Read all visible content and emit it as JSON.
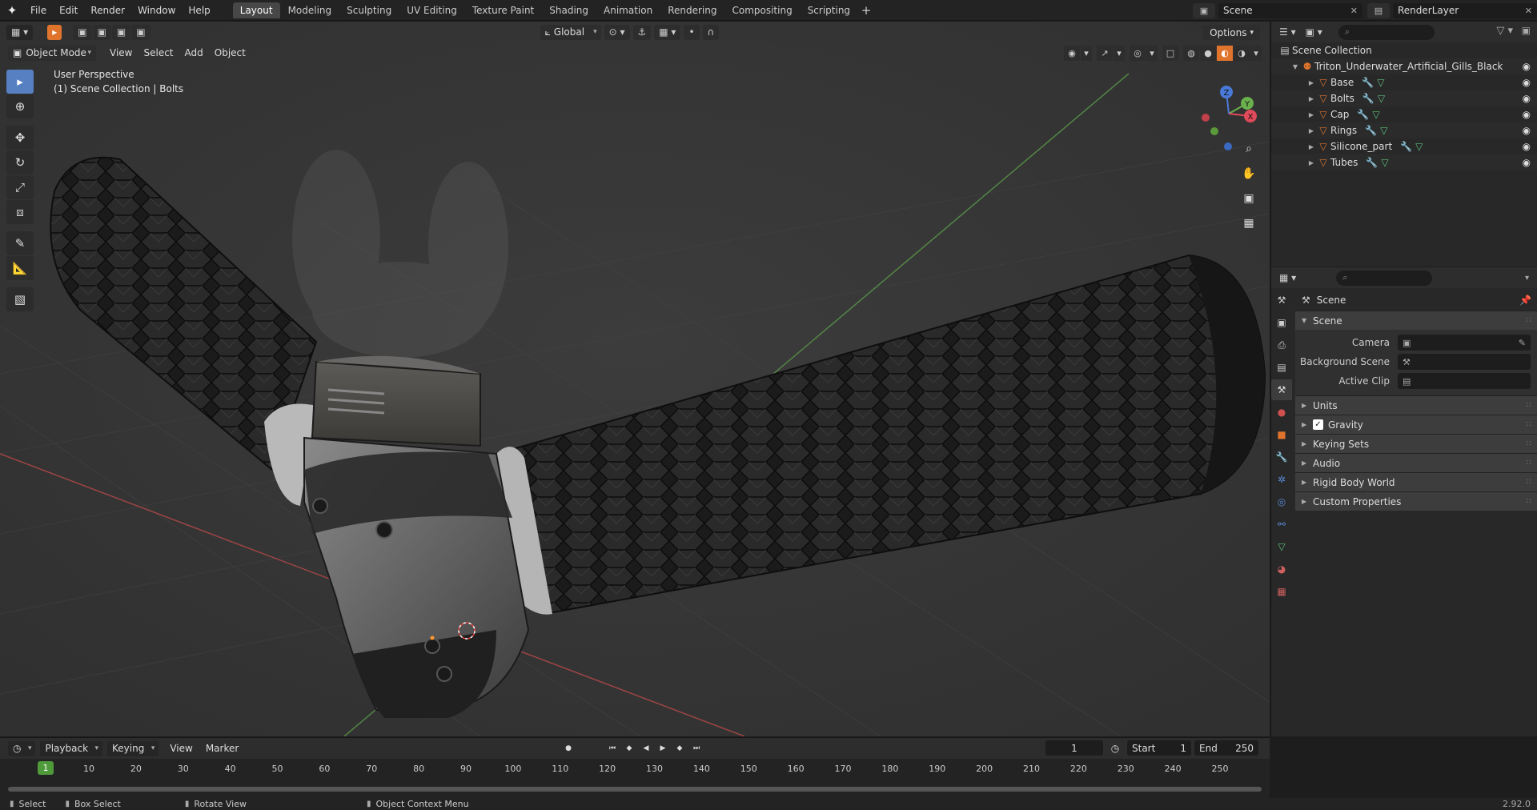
{
  "menu": [
    "File",
    "Edit",
    "Render",
    "Window",
    "Help"
  ],
  "workspaces": [
    {
      "label": "Layout",
      "active": true
    },
    {
      "label": "Modeling"
    },
    {
      "label": "Sculpting"
    },
    {
      "label": "UV Editing"
    },
    {
      "label": "Texture Paint"
    },
    {
      "label": "Shading"
    },
    {
      "label": "Animation"
    },
    {
      "label": "Rendering"
    },
    {
      "label": "Compositing"
    },
    {
      "label": "Scripting"
    }
  ],
  "scene_name": "Scene",
  "view_layer": "RenderLayer",
  "viewport": {
    "mode": "Object Mode",
    "menus": [
      "View",
      "Select",
      "Add",
      "Object"
    ],
    "transform_orientation": "Global",
    "options_label": "Options",
    "overlay_line1": "User Perspective",
    "overlay_line2": "(1) Scene Collection | Bolts"
  },
  "gizmo_axes": {
    "x": "X",
    "y": "Y",
    "z": "Z"
  },
  "outliner": {
    "root": "Scene Collection",
    "object": "Triton_Underwater_Artificial_Gills_Black",
    "children": [
      "Base",
      "Bolts",
      "Cap",
      "Rings",
      "Silicone_part",
      "Tubes"
    ]
  },
  "properties": {
    "context": "Scene",
    "panel": "Scene",
    "rows": [
      {
        "label": "Camera"
      },
      {
        "label": "Background Scene"
      },
      {
        "label": "Active Clip"
      }
    ],
    "collapsed": [
      "Units",
      "Gravity",
      "Keying Sets",
      "Audio",
      "Rigid Body World",
      "Custom Properties"
    ]
  },
  "timeline": {
    "menus": [
      "Playback",
      "Keying",
      "View",
      "Marker"
    ],
    "current_frame": "1",
    "start_label": "Start",
    "start": "1",
    "end_label": "End",
    "end": "250",
    "ticks": [
      "10",
      "20",
      "30",
      "40",
      "50",
      "60",
      "70",
      "80",
      "90",
      "100",
      "110",
      "120",
      "130",
      "140",
      "150",
      "160",
      "170",
      "180",
      "190",
      "200",
      "210",
      "220",
      "230",
      "240",
      "250"
    ],
    "cursor_label": "1"
  },
  "statusbar": {
    "select": "Select",
    "box_select": "Box Select",
    "rotate_view": "Rotate View",
    "context_menu": "Object Context Menu",
    "version": "2.92.0"
  },
  "colors": {
    "accent": "#5680c2",
    "orange": "#e0742c",
    "frame_green": "#4f9a3a",
    "x_axis": "#e04a5a",
    "y_axis": "#6ab04c",
    "z_axis": "#4a7ad8"
  }
}
